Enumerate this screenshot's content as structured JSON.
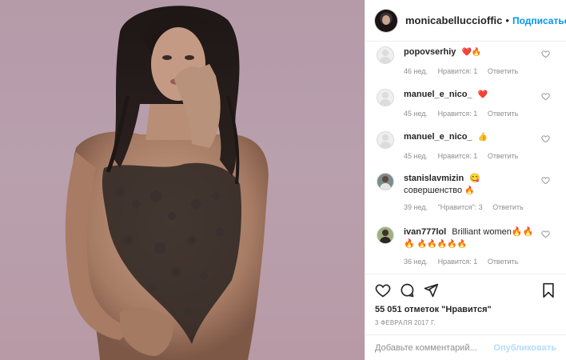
{
  "header": {
    "username": "monicabelluccioffic",
    "separator": "•",
    "follow_label": "Подписаться",
    "more_icon": "more-dots-icon"
  },
  "comments": [
    {
      "user": "popovserhiy",
      "text": "",
      "emoji": "❤️🔥",
      "age": "46 нед.",
      "likes": "Нравится: 1",
      "reply": "Ответить"
    },
    {
      "user": "manuel_e_nico_",
      "text": "",
      "emoji": "❤️",
      "age": "45 нед.",
      "likes": "Нравится: 1",
      "reply": "Ответить"
    },
    {
      "user": "manuel_e_nico_",
      "text": "",
      "emoji": "👍",
      "age": "45 нед.",
      "likes": "Нравится: 1",
      "reply": "Ответить"
    },
    {
      "user": "stanislavmizin",
      "text": "😋 совершенство",
      "emoji": "🔥",
      "age": "39 нед.",
      "likes": "\"Нравится\": 3",
      "reply": "Ответить"
    },
    {
      "user": "ivan777lol",
      "text": "Brilliant women🔥🔥🔥",
      "emoji": "🔥🔥🔥🔥🔥",
      "age": "36 нед.",
      "likes": "Нравится: 1",
      "reply": "Ответить"
    }
  ],
  "actions": {
    "like_icon": "heart-icon",
    "comment_icon": "comment-icon",
    "share_icon": "paper-plane-icon",
    "save_icon": "bookmark-icon"
  },
  "likes": {
    "count": "55 051",
    "label": "отметок \"Нравится\""
  },
  "date": "3 февраля 2017 г.",
  "add_comment": {
    "placeholder": "Добавьте комментарий...",
    "publish_label": "Опубликовать"
  },
  "colors": {
    "accent": "#0095f6",
    "publish_disabled": "#b3dbff",
    "muted": "#8e8e8e",
    "text": "#262626",
    "border": "#efefef",
    "photo_bg": "#b89ca9",
    "heart_red": "#ed4956"
  }
}
